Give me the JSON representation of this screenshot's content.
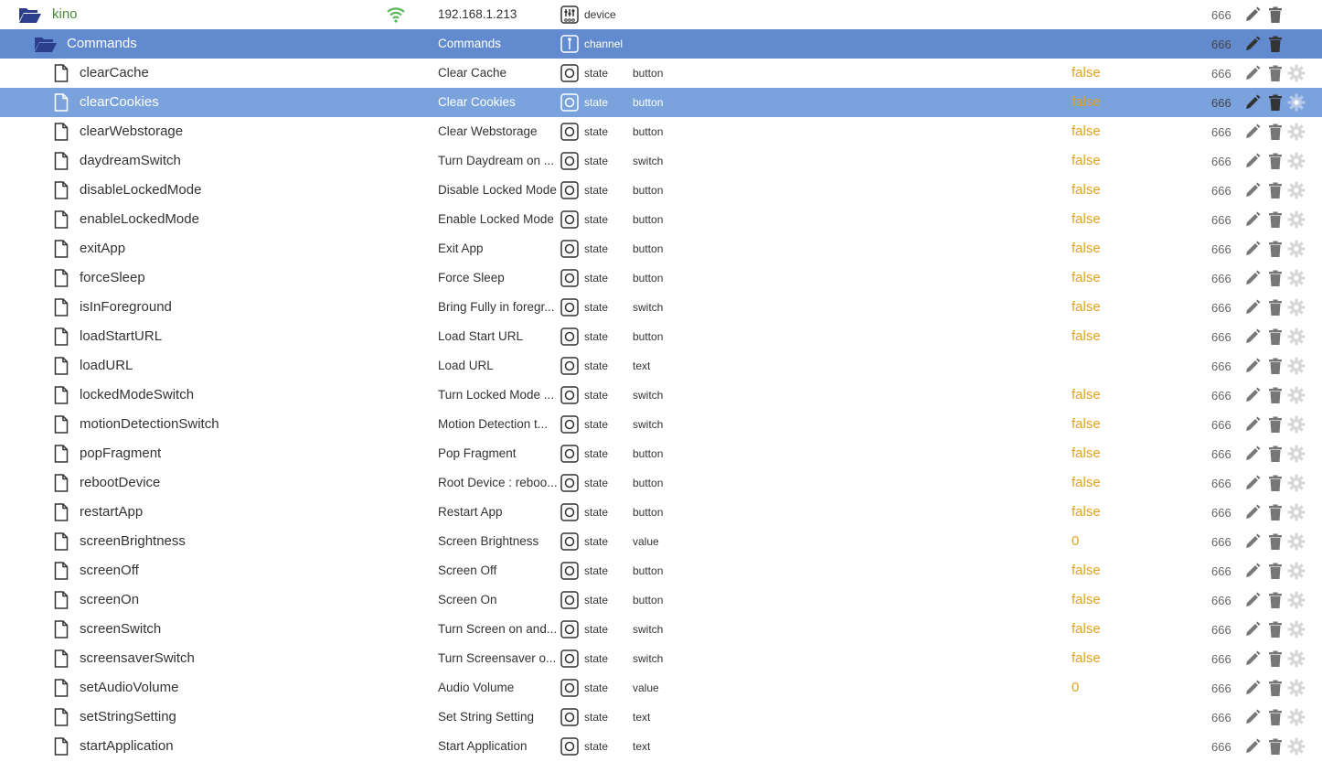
{
  "device": {
    "name": "kino",
    "ip": "192.168.1.213",
    "type_icon": "device-icon",
    "type_label": "device",
    "acl": "666"
  },
  "channel": {
    "name": "Commands",
    "desc": "Commands",
    "type_icon": "channel-icon",
    "type_label": "channel",
    "acl": "666"
  },
  "states": [
    {
      "name": "clearCache",
      "desc": "Clear Cache",
      "type": "state",
      "role": "button",
      "value": "false",
      "acl": "666"
    },
    {
      "name": "clearCookies",
      "desc": "Clear Cookies",
      "type": "state",
      "role": "button",
      "value": "false",
      "acl": "666",
      "selected": true
    },
    {
      "name": "clearWebstorage",
      "desc": "Clear Webstorage",
      "type": "state",
      "role": "button",
      "value": "false",
      "acl": "666"
    },
    {
      "name": "daydreamSwitch",
      "desc": "Turn Daydream on ...",
      "type": "state",
      "role": "switch",
      "value": "false",
      "acl": "666"
    },
    {
      "name": "disableLockedMode",
      "desc": "Disable Locked Mode",
      "type": "state",
      "role": "button",
      "value": "false",
      "acl": "666"
    },
    {
      "name": "enableLockedMode",
      "desc": "Enable Locked Mode",
      "type": "state",
      "role": "button",
      "value": "false",
      "acl": "666"
    },
    {
      "name": "exitApp",
      "desc": "Exit App",
      "type": "state",
      "role": "button",
      "value": "false",
      "acl": "666"
    },
    {
      "name": "forceSleep",
      "desc": "Force Sleep",
      "type": "state",
      "role": "button",
      "value": "false",
      "acl": "666"
    },
    {
      "name": "isInForeground",
      "desc": "Bring Fully in foregr...",
      "type": "state",
      "role": "switch",
      "value": "false",
      "acl": "666"
    },
    {
      "name": "loadStartURL",
      "desc": "Load Start URL",
      "type": "state",
      "role": "button",
      "value": "false",
      "acl": "666"
    },
    {
      "name": "loadURL",
      "desc": "Load URL",
      "type": "state",
      "role": "text",
      "value": "",
      "acl": "666"
    },
    {
      "name": "lockedModeSwitch",
      "desc": "Turn Locked Mode ...",
      "type": "state",
      "role": "switch",
      "value": "false",
      "acl": "666"
    },
    {
      "name": "motionDetectionSwitch",
      "desc": "Motion Detection t...",
      "type": "state",
      "role": "switch",
      "value": "false",
      "acl": "666"
    },
    {
      "name": "popFragment",
      "desc": "Pop Fragment",
      "type": "state",
      "role": "button",
      "value": "false",
      "acl": "666"
    },
    {
      "name": "rebootDevice",
      "desc": "Root Device : reboo...",
      "type": "state",
      "role": "button",
      "value": "false",
      "acl": "666"
    },
    {
      "name": "restartApp",
      "desc": "Restart App",
      "type": "state",
      "role": "button",
      "value": "false",
      "acl": "666"
    },
    {
      "name": "screenBrightness",
      "desc": "Screen Brightness",
      "type": "state",
      "role": "value",
      "value": "0",
      "acl": "666"
    },
    {
      "name": "screenOff",
      "desc": "Screen Off",
      "type": "state",
      "role": "button",
      "value": "false",
      "acl": "666"
    },
    {
      "name": "screenOn",
      "desc": "Screen On",
      "type": "state",
      "role": "button",
      "value": "false",
      "acl": "666"
    },
    {
      "name": "screenSwitch",
      "desc": "Turn Screen on and...",
      "type": "state",
      "role": "switch",
      "value": "false",
      "acl": "666"
    },
    {
      "name": "screensaverSwitch",
      "desc": "Turn Screensaver o...",
      "type": "state",
      "role": "switch",
      "value": "false",
      "acl": "666"
    },
    {
      "name": "setAudioVolume",
      "desc": "Audio Volume",
      "type": "state",
      "role": "value",
      "value": "0",
      "acl": "666"
    },
    {
      "name": "setStringSetting",
      "desc": "Set String Setting",
      "type": "state",
      "role": "text",
      "value": "",
      "acl": "666"
    },
    {
      "name": "startApplication",
      "desc": "Start Application",
      "type": "state",
      "role": "text",
      "value": "",
      "acl": "666"
    }
  ],
  "icons": {
    "folder": "folder-open-icon",
    "file": "file-icon",
    "wifi": "wifi-icon",
    "state": "state-icon",
    "edit": "pencil-icon",
    "delete": "trash-icon",
    "settings": "gear-icon"
  },
  "colors": {
    "channel_row": "#628bcf",
    "selected_row": "#7aa3dd",
    "value": "#e2a21f",
    "device_name": "#4a8a3a",
    "folder": "#2d3e8c"
  }
}
